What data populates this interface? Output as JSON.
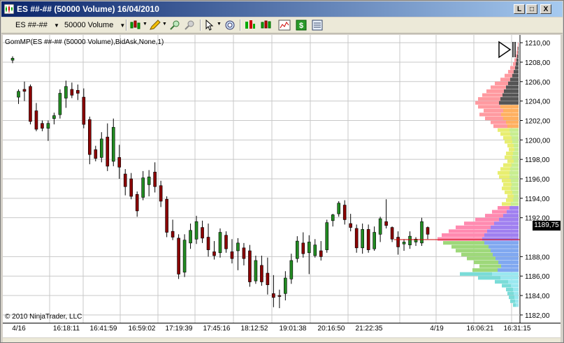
{
  "window": {
    "title": "ES ##-## (50000 Volume)  16/04/2010",
    "min_label": "L",
    "max_label": "□",
    "close_label": "X"
  },
  "toolbar": {
    "instrument": "ES ##-##",
    "period": "50000 Volume"
  },
  "chart": {
    "indicator_label": "GomMP(ES ##-## (50000 Volume),BidAsk,None,1)",
    "copyright": "© 2010 NinjaTrader, LLC",
    "last_price": "1189,75",
    "y_axis": [
      "1210,00",
      "1208,00",
      "1206,00",
      "1204,00",
      "1202,00",
      "1200,00",
      "1198,00",
      "1196,00",
      "1194,00",
      "1192,00",
      "1188,00",
      "1186,00",
      "1184,00",
      "1182,00"
    ],
    "x_axis": [
      "4/16",
      "16:18:11",
      "16:41:59",
      "16:59:02",
      "17:19:39",
      "17:45:16",
      "18:12:52",
      "19:01:38",
      "20:16:50",
      "21:22:35",
      "4/19",
      "16:06:21",
      "16:31:15"
    ],
    "colors": {
      "up": "#228b22",
      "down": "#8b0000",
      "grid": "#c8c8c8"
    }
  },
  "chart_data": {
    "type": "candlestick",
    "ylim": [
      1181.2,
      1210.8
    ],
    "candles": [
      {
        "o": 1208.2,
        "h": 1208.6,
        "l": 1207.9,
        "c": 1208.4
      },
      {
        "o": 1204.4,
        "h": 1205.2,
        "l": 1203.7,
        "c": 1205.0
      },
      {
        "o": 1205.2,
        "h": 1206.0,
        "l": 1204.0,
        "c": 1205.0
      },
      {
        "o": 1205.5,
        "h": 1205.7,
        "l": 1201.6,
        "c": 1201.9
      },
      {
        "o": 1203.0,
        "h": 1203.8,
        "l": 1200.9,
        "c": 1201.1
      },
      {
        "o": 1201.7,
        "h": 1202.0,
        "l": 1200.9,
        "c": 1201.2
      },
      {
        "o": 1201.2,
        "h": 1202.0,
        "l": 1199.9,
        "c": 1201.7
      },
      {
        "o": 1202.2,
        "h": 1202.8,
        "l": 1201.6,
        "c": 1202.5
      },
      {
        "o": 1202.6,
        "h": 1205.2,
        "l": 1202.2,
        "c": 1204.8
      },
      {
        "o": 1204.3,
        "h": 1206.1,
        "l": 1203.3,
        "c": 1205.5
      },
      {
        "o": 1205.2,
        "h": 1205.9,
        "l": 1204.3,
        "c": 1204.6
      },
      {
        "o": 1205.1,
        "h": 1205.7,
        "l": 1204.1,
        "c": 1204.8
      },
      {
        "o": 1204.4,
        "h": 1205.3,
        "l": 1201.2,
        "c": 1201.6
      },
      {
        "o": 1202.1,
        "h": 1202.4,
        "l": 1197.5,
        "c": 1198.5
      },
      {
        "o": 1199.0,
        "h": 1199.4,
        "l": 1197.8,
        "c": 1198.1
      },
      {
        "o": 1198.2,
        "h": 1200.8,
        "l": 1197.7,
        "c": 1200.1
      },
      {
        "o": 1200.3,
        "h": 1201.7,
        "l": 1196.8,
        "c": 1197.3
      },
      {
        "o": 1197.8,
        "h": 1202.2,
        "l": 1197.3,
        "c": 1201.3
      },
      {
        "o": 1198.2,
        "h": 1199.5,
        "l": 1196.0,
        "c": 1197.2
      },
      {
        "o": 1196.5,
        "h": 1197.0,
        "l": 1194.3,
        "c": 1195.2
      },
      {
        "o": 1196.0,
        "h": 1196.6,
        "l": 1193.9,
        "c": 1194.2
      },
      {
        "o": 1194.4,
        "h": 1194.7,
        "l": 1192.1,
        "c": 1192.7
      },
      {
        "o": 1194.1,
        "h": 1196.8,
        "l": 1193.8,
        "c": 1196.1
      },
      {
        "o": 1195.4,
        "h": 1196.9,
        "l": 1194.2,
        "c": 1196.2
      },
      {
        "o": 1196.7,
        "h": 1197.7,
        "l": 1194.6,
        "c": 1195.2
      },
      {
        "o": 1195.3,
        "h": 1195.8,
        "l": 1193.1,
        "c": 1193.7
      },
      {
        "o": 1193.9,
        "h": 1194.2,
        "l": 1190.0,
        "c": 1190.5
      },
      {
        "o": 1190.6,
        "h": 1191.8,
        "l": 1189.7,
        "c": 1190.0
      },
      {
        "o": 1189.9,
        "h": 1190.3,
        "l": 1185.7,
        "c": 1186.2
      },
      {
        "o": 1186.4,
        "h": 1190.3,
        "l": 1185.9,
        "c": 1189.7
      },
      {
        "o": 1189.4,
        "h": 1191.4,
        "l": 1188.8,
        "c": 1190.7
      },
      {
        "o": 1189.8,
        "h": 1192.2,
        "l": 1189.3,
        "c": 1191.6
      },
      {
        "o": 1191.0,
        "h": 1191.7,
        "l": 1189.4,
        "c": 1189.9
      },
      {
        "o": 1190.0,
        "h": 1191.4,
        "l": 1188.0,
        "c": 1188.7
      },
      {
        "o": 1188.5,
        "h": 1189.6,
        "l": 1187.7,
        "c": 1188.1
      },
      {
        "o": 1188.4,
        "h": 1190.9,
        "l": 1187.9,
        "c": 1190.5
      },
      {
        "o": 1190.2,
        "h": 1190.6,
        "l": 1188.4,
        "c": 1188.8
      },
      {
        "o": 1188.5,
        "h": 1189.8,
        "l": 1187.3,
        "c": 1187.8
      },
      {
        "o": 1188.6,
        "h": 1189.9,
        "l": 1186.6,
        "c": 1189.4
      },
      {
        "o": 1188.9,
        "h": 1189.4,
        "l": 1187.1,
        "c": 1187.8
      },
      {
        "o": 1188.6,
        "h": 1189.2,
        "l": 1184.9,
        "c": 1185.4
      },
      {
        "o": 1185.5,
        "h": 1188.1,
        "l": 1185.2,
        "c": 1187.6
      },
      {
        "o": 1187.1,
        "h": 1188.1,
        "l": 1185.0,
        "c": 1185.4
      },
      {
        "o": 1186.3,
        "h": 1187.9,
        "l": 1184.1,
        "c": 1185.1
      },
      {
        "o": 1184.2,
        "h": 1186.1,
        "l": 1182.8,
        "c": 1183.8
      },
      {
        "o": 1184.0,
        "h": 1184.6,
        "l": 1182.7,
        "c": 1183.9
      },
      {
        "o": 1184.2,
        "h": 1186.5,
        "l": 1183.5,
        "c": 1185.8
      },
      {
        "o": 1185.7,
        "h": 1188.3,
        "l": 1185.2,
        "c": 1187.6
      },
      {
        "o": 1187.8,
        "h": 1190.1,
        "l": 1187.4,
        "c": 1189.6
      },
      {
        "o": 1189.4,
        "h": 1190.5,
        "l": 1187.9,
        "c": 1188.3
      },
      {
        "o": 1188.4,
        "h": 1190.2,
        "l": 1186.2,
        "c": 1189.5
      },
      {
        "o": 1188.1,
        "h": 1189.8,
        "l": 1187.9,
        "c": 1189.2
      },
      {
        "o": 1188.6,
        "h": 1189.6,
        "l": 1187.6,
        "c": 1188.0
      },
      {
        "o": 1188.7,
        "h": 1191.8,
        "l": 1188.4,
        "c": 1191.5
      },
      {
        "o": 1191.7,
        "h": 1192.4,
        "l": 1191.1,
        "c": 1192.3
      },
      {
        "o": 1192.4,
        "h": 1193.7,
        "l": 1192.1,
        "c": 1193.5
      },
      {
        "o": 1193.3,
        "h": 1193.8,
        "l": 1191.3,
        "c": 1191.8
      },
      {
        "o": 1191.4,
        "h": 1192.4,
        "l": 1190.6,
        "c": 1191.0
      },
      {
        "o": 1190.9,
        "h": 1191.3,
        "l": 1188.4,
        "c": 1188.9
      },
      {
        "o": 1188.9,
        "h": 1191.4,
        "l": 1188.3,
        "c": 1190.8
      },
      {
        "o": 1190.8,
        "h": 1191.3,
        "l": 1188.4,
        "c": 1188.7
      },
      {
        "o": 1188.8,
        "h": 1191.1,
        "l": 1188.6,
        "c": 1190.5
      },
      {
        "o": 1190.3,
        "h": 1192.1,
        "l": 1189.5,
        "c": 1191.9
      },
      {
        "o": 1191.6,
        "h": 1193.9,
        "l": 1190.9,
        "c": 1191.2
      },
      {
        "o": 1191.0,
        "h": 1191.1,
        "l": 1189.5,
        "c": 1189.8
      },
      {
        "o": 1190.0,
        "h": 1190.6,
        "l": 1188.2,
        "c": 1189.0
      },
      {
        "o": 1189.3,
        "h": 1189.8,
        "l": 1188.6,
        "c": 1189.5
      },
      {
        "o": 1189.2,
        "h": 1190.6,
        "l": 1188.8,
        "c": 1190.1
      },
      {
        "o": 1189.5,
        "h": 1190.0,
        "l": 1189.1,
        "c": 1189.8
      },
      {
        "o": 1189.4,
        "h": 1192.0,
        "l": 1189.1,
        "c": 1191.6
      },
      {
        "o": 1191.0,
        "h": 1191.1,
        "l": 1189.8,
        "c": 1190.3
      }
    ]
  }
}
